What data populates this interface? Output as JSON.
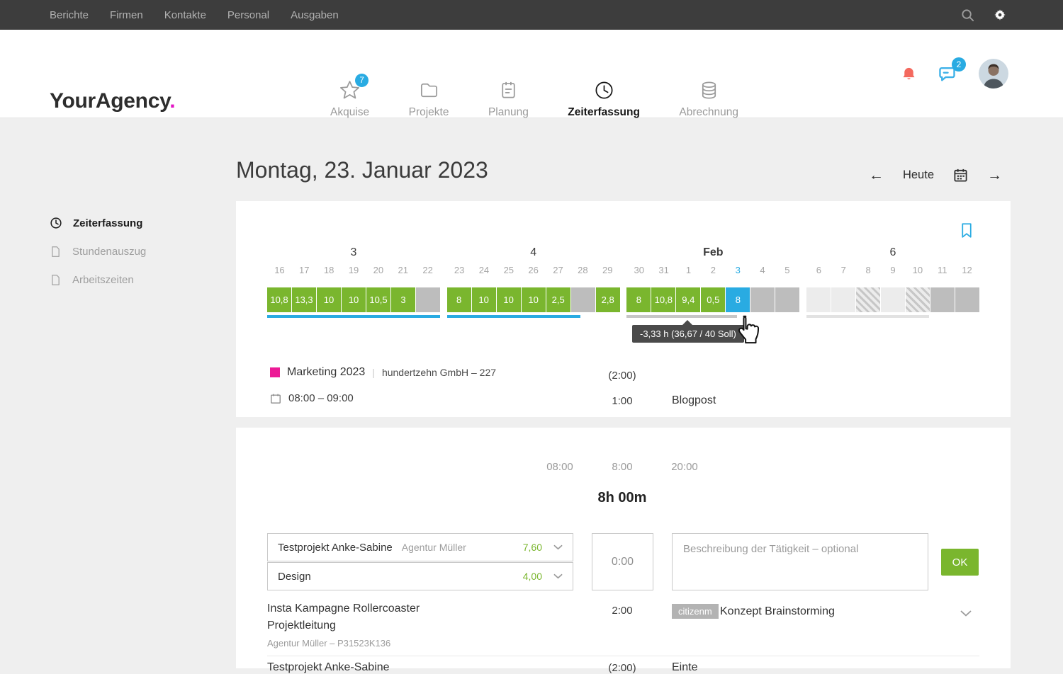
{
  "colors": {
    "accent_blue": "#29abe2",
    "tracked_green": "#7ab62e",
    "brand_magenta": "#e313c4",
    "project_pink": "#ec1a96",
    "alert_red": "#f4695e",
    "bar_gray": "#bdbdbd",
    "bar_future": "#ececec"
  },
  "topbar": {
    "items": [
      "Berichte",
      "Firmen",
      "Kontakte",
      "Personal",
      "Ausgaben"
    ]
  },
  "header": {
    "logo_text": "YourAgency",
    "logo_dot": ".",
    "nav_items": [
      {
        "label": "Akquise",
        "icon": "star-icon",
        "badge": "7",
        "active": false
      },
      {
        "label": "Projekte",
        "icon": "folder-icon",
        "active": false
      },
      {
        "label": "Planung",
        "icon": "planner-icon",
        "active": false
      },
      {
        "label": "Zeiterfassung",
        "icon": "clock-icon",
        "active": true
      },
      {
        "label": "Abrechnung",
        "icon": "database-icon",
        "active": false
      }
    ],
    "chat_badge": "2"
  },
  "sidebar": {
    "items": [
      {
        "label": "Zeiterfassung",
        "icon": "clock-small-icon",
        "active": true
      },
      {
        "label": "Stundenauszug",
        "icon": "document-icon",
        "active": false
      },
      {
        "label": "Arbeitszeiten",
        "icon": "document-icon",
        "active": false
      }
    ]
  },
  "toolbar": {
    "title": "Montag, 23. Januar 2023",
    "today_label": "Heute",
    "prev_arrow": "←",
    "next_arrow": "→"
  },
  "week_strip": {
    "tooltip": "-3,33 h (36,67 / 40 Soll)",
    "weeks": [
      {
        "label": "3",
        "bold": false,
        "underline": "blue",
        "underline_frac": 1,
        "days": [
          {
            "day": "16",
            "value": "10,8",
            "type": "green"
          },
          {
            "day": "17",
            "value": "13,3",
            "type": "green"
          },
          {
            "day": "18",
            "value": "10",
            "type": "green"
          },
          {
            "day": "19",
            "value": "10",
            "type": "green"
          },
          {
            "day": "20",
            "value": "10,5",
            "type": "green"
          },
          {
            "day": "21",
            "value": "3",
            "type": "green"
          },
          {
            "day": "22",
            "type": "gray"
          }
        ]
      },
      {
        "label": "4",
        "bold": false,
        "underline": "blue",
        "underline_frac": 0.77,
        "days": [
          {
            "day": "23",
            "value": "8",
            "type": "green"
          },
          {
            "day": "24",
            "value": "10",
            "type": "green"
          },
          {
            "day": "25",
            "value": "10",
            "type": "green"
          },
          {
            "day": "26",
            "value": "10",
            "type": "green"
          },
          {
            "day": "27",
            "value": "2,5",
            "type": "green"
          },
          {
            "day": "28",
            "type": "gray"
          },
          {
            "day": "29",
            "value": "2,8",
            "type": "green"
          }
        ]
      },
      {
        "label": "Feb",
        "bold": true,
        "underline": "gray",
        "underline_frac": 0.64,
        "days": [
          {
            "day": "30",
            "value": "8",
            "type": "green"
          },
          {
            "day": "31",
            "value": "10,8",
            "type": "green"
          },
          {
            "day": "1",
            "value": "9,4",
            "type": "green"
          },
          {
            "day": "2",
            "value": "0,5",
            "type": "green"
          },
          {
            "day": "3",
            "value": "8",
            "type": "today",
            "today": true
          },
          {
            "day": "4",
            "type": "gray"
          },
          {
            "day": "5",
            "type": "gray"
          }
        ]
      },
      {
        "label": "6",
        "bold": false,
        "underline": "lightgray",
        "underline_frac": 0.71,
        "days": [
          {
            "day": "6",
            "type": "future"
          },
          {
            "day": "7",
            "type": "future"
          },
          {
            "day": "8",
            "type": "hatched"
          },
          {
            "day": "9",
            "type": "future"
          },
          {
            "day": "10",
            "type": "hatched"
          },
          {
            "day": "11",
            "type": "gray"
          },
          {
            "day": "12",
            "type": "gray"
          }
        ]
      }
    ]
  },
  "tracked_entry": {
    "project": "Marketing 2023",
    "separator": "|",
    "client": "hundertzehn GmbH – 227",
    "planned": "(2:00)",
    "time_range": "08:00 – 09:00",
    "duration": "1:00",
    "activity": "Blogpost"
  },
  "day_summary": {
    "start": "08:00",
    "worked": "8:00",
    "end": "20:00",
    "total": "8h 00m"
  },
  "entry_form": {
    "project_select": {
      "name": "Testprojekt Anke-Sabine",
      "client": "Agentur Müller",
      "hours": "7,60"
    },
    "task_select": {
      "name": "Design",
      "hours": "4,00"
    },
    "duration_value": "0:00",
    "description_placeholder": "Beschreibung der Tätigkeit – optional",
    "ok_label": "OK"
  },
  "entries": [
    {
      "title_line1": "Insta Kampagne Rollercoaster",
      "title_line2": "Projektleitung",
      "subtitle": "Agentur Müller – P31523K136",
      "duration": "2:00",
      "tag": "citizenm",
      "activity": "Konzept Brainstorming"
    },
    {
      "title_line1": "Testprojekt Anke-Sabine",
      "duration": "(2:00)",
      "activity": "Einte"
    }
  ]
}
